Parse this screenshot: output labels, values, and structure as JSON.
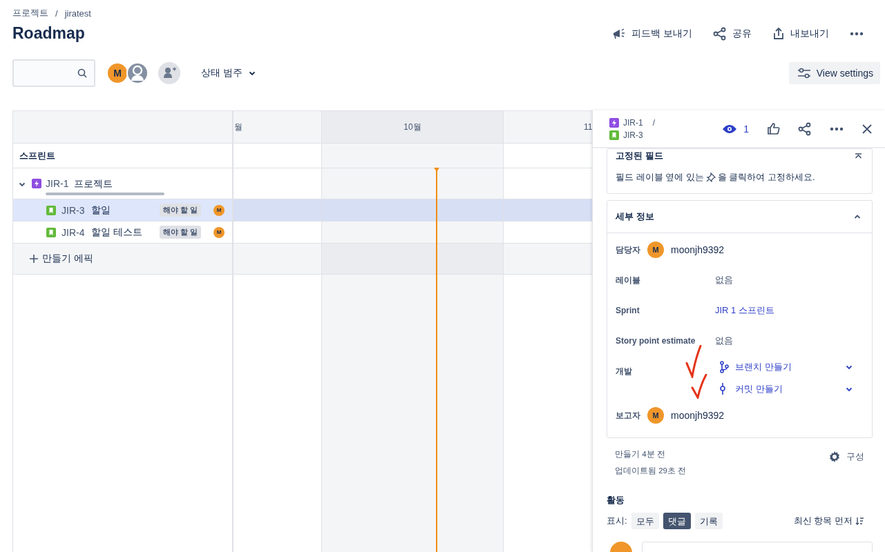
{
  "breadcrumb": {
    "items": [
      "프로젝트",
      "jiratest"
    ],
    "separator": "/"
  },
  "title": "Roadmap",
  "actions": [
    {
      "kind": "feedback",
      "label": "피드백 보내기"
    },
    {
      "kind": "share",
      "label": "공유"
    },
    {
      "kind": "export",
      "label": "내보내기"
    },
    {
      "kind": "more"
    }
  ],
  "toolbar": {
    "avatars": [
      {
        "kind": "initial",
        "initial": "M",
        "color": "#f0962a"
      },
      {
        "kind": "silhouette",
        "color": "#8590a2"
      }
    ],
    "filter": "상태 범주",
    "view_settings": "View settings"
  },
  "timeline": {
    "months": [
      "월",
      "10월",
      "11"
    ],
    "sprint_label": "스프린트",
    "epics": [
      {
        "key": "JIR-1",
        "title": "프로젝트",
        "expanded": true,
        "level": 0,
        "children": [
          {
            "key": "JIR-3",
            "title": "할일",
            "status": "해야 할 일",
            "assignee": "M",
            "selected": true
          },
          {
            "key": "JIR-4",
            "title": "할일 테스트",
            "status": "해야 할 일",
            "assignee": "M",
            "selected": false
          }
        ]
      }
    ],
    "create_epic": "만들기 에픽"
  },
  "panel": {
    "breadcrumb": [
      {
        "kind": "epic",
        "key": "JIR-1"
      },
      {
        "kind": "story",
        "key": "JIR-3"
      }
    ],
    "separator": "/",
    "watchers": "1",
    "pinned": {
      "title": "고정된 필드",
      "hint_before": "필드 레이블 옆에 있는",
      "hint_after": "을 클릭하여 고정하세요."
    },
    "details": {
      "title": "세부 정보",
      "expanded": true,
      "fields": [
        {
          "kind": "user",
          "label": "담당자",
          "initial": "M",
          "value": "moonjh9392"
        },
        {
          "kind": "text",
          "label": "레이블",
          "value": "없음"
        },
        {
          "kind": "link",
          "label": "Sprint",
          "value": "JIR 1 스프린트"
        },
        {
          "kind": "text",
          "label": "Story point estimate",
          "value": "없음"
        },
        {
          "kind": "dev",
          "label": "개발",
          "items": [
            {
              "kind": "branch",
              "text": "브랜치 만들기"
            },
            {
              "kind": "commit",
              "text": "커밋 만들기"
            }
          ]
        },
        {
          "kind": "user",
          "label": "보고자",
          "initial": "M",
          "value": "moonjh9392"
        }
      ]
    },
    "created": "만들기 4분 전",
    "updated": "업데이트됨 29초 전",
    "configure": "구성",
    "activity": {
      "title": "활동",
      "show_label": "표시:",
      "filters": [
        {
          "label": "모두",
          "selected": false
        },
        {
          "label": "댓글",
          "selected": true
        },
        {
          "label": "기록",
          "selected": false
        }
      ],
      "sort": "최신 항목 먼저"
    }
  }
}
